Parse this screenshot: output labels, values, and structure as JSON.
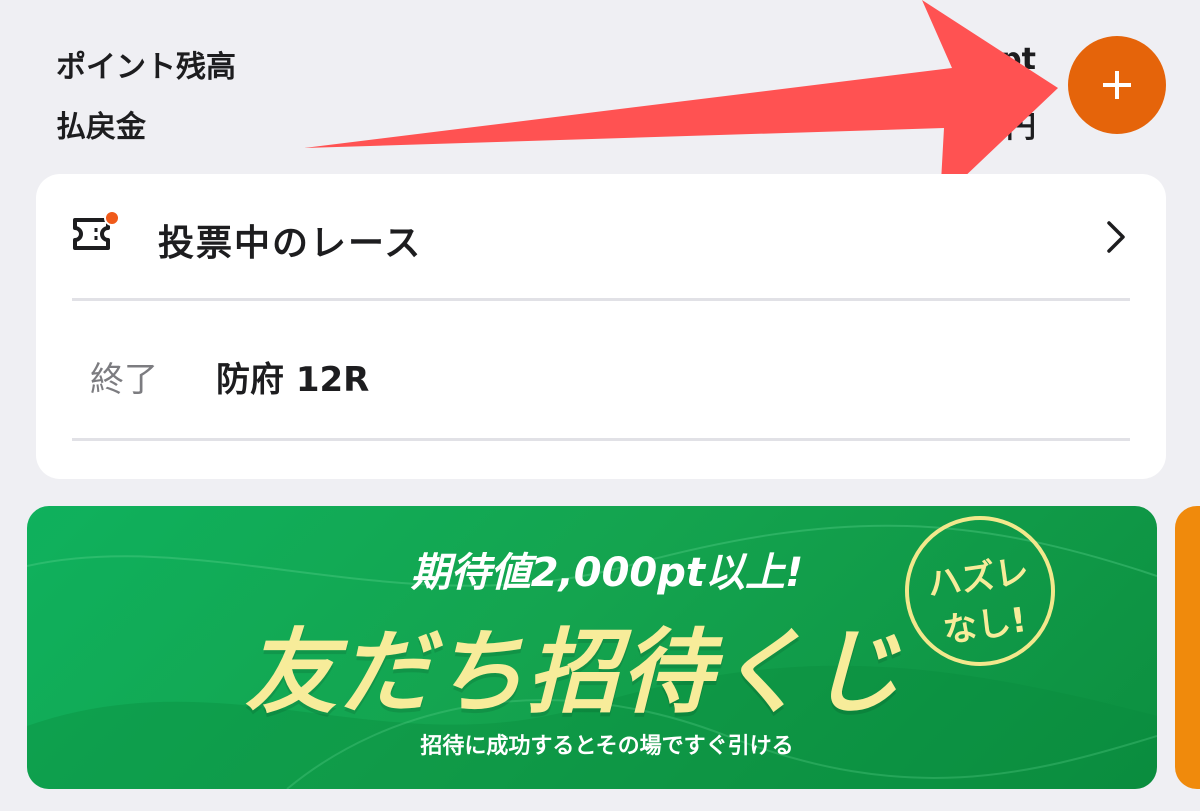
{
  "balance": {
    "points_label": "ポイント残高",
    "points_value": "2pt",
    "refund_label": "払戻金",
    "refund_value": "円"
  },
  "add_button": {
    "icon": "plus-icon"
  },
  "annotation": {
    "color": "#ff5252"
  },
  "card": {
    "title": "投票中のレース",
    "icon": "ticket-icon",
    "race": {
      "status": "終了",
      "name": "防府 12R"
    }
  },
  "banner": {
    "subtitle": "期待値2,000pt以上!",
    "title": "友だち招待くじ",
    "badge_line1": "ハズレ",
    "badge_line2": "なし!",
    "note": "招待に成功するとその場ですぐ引ける"
  },
  "colors": {
    "accent_orange": "#e5640a",
    "banner_green": "#12a652",
    "banner_gold": "#f7ec9a"
  }
}
